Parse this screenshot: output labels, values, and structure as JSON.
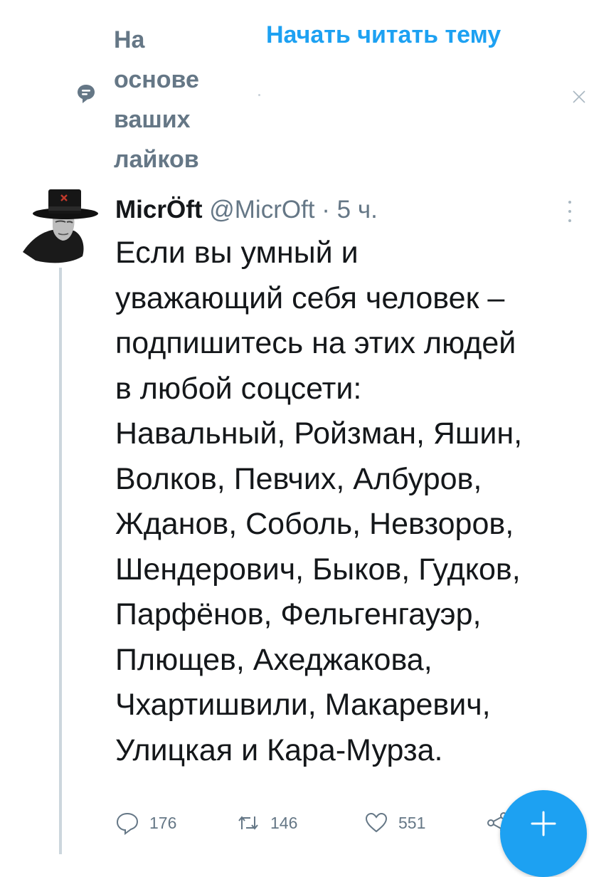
{
  "context": {
    "icon": "speech-bubble-icon",
    "label": "На основе ваших лайков",
    "start_thread": "Начать читать тему",
    "dismiss_icon": "close-icon"
  },
  "tweet": {
    "display_name": "MicrÖft",
    "handle": "@MicrOft",
    "separator": "·",
    "time": "5 ч.",
    "text_lines": [
      "Если вы умный и",
      "уважающий себя человек –",
      "подпишитесь на этих людей",
      "в любой соцсети:",
      "Навальный, Ройзман, Яшин,",
      "Волков, Певчих, Албуров,",
      "Жданов, Соболь, Невзоров,",
      "Шендерович, Быков, Гудков,",
      "Парфёнов, Фельгенгауэр,",
      "Плющев, Ахеджакова,",
      "Чхартишвили, Макаревич,",
      "Улицкая и Кара-Мурза."
    ],
    "actions": {
      "replies": "176",
      "retweets": "146",
      "likes": "551"
    }
  },
  "colors": {
    "accent": "#1da1f2",
    "text": "#14171a",
    "secondary": "#657786",
    "divider": "#ccd6dd"
  },
  "icons": {
    "reply": "reply-icon",
    "retweet": "retweet-icon",
    "like": "heart-icon",
    "share": "share-icon",
    "compose": "plus-icon",
    "more": "more-vertical-icon"
  }
}
